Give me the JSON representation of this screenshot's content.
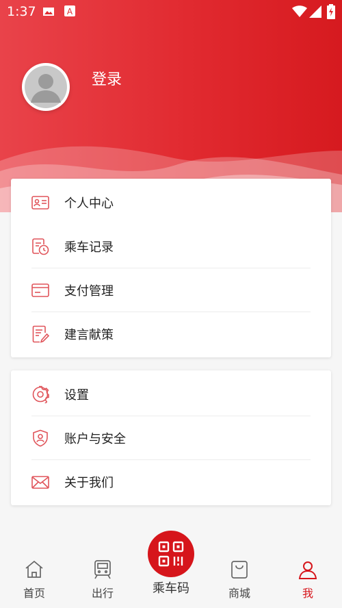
{
  "status_bar": {
    "time": "1:37"
  },
  "profile": {
    "login_label": "登录"
  },
  "menu_group_1": [
    {
      "label": "个人中心",
      "icon": "id-card-icon"
    },
    {
      "label": "乘车记录",
      "icon": "ride-record-icon"
    },
    {
      "label": "支付管理",
      "icon": "payment-card-icon"
    },
    {
      "label": "建言献策",
      "icon": "suggestion-icon"
    }
  ],
  "menu_group_2": [
    {
      "label": "设置",
      "icon": "gear-icon"
    },
    {
      "label": "账户与安全",
      "icon": "shield-icon"
    },
    {
      "label": "关于我们",
      "icon": "mail-icon"
    }
  ],
  "tabbar": {
    "home": "首页",
    "travel": "出行",
    "ride_code": "乘车码",
    "mall": "商城",
    "me": "我"
  },
  "colors": {
    "accent": "#d6151b",
    "header": "#e12a30"
  }
}
